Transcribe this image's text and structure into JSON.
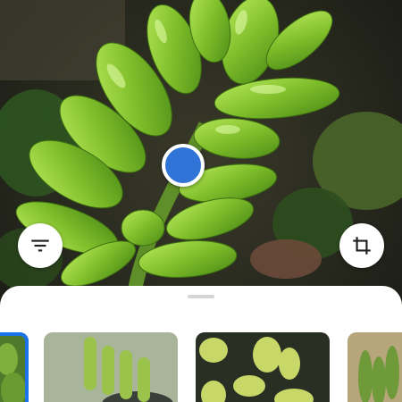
{
  "screen": {
    "background_color": "#1b1f16"
  },
  "photo": {
    "subject": "jelly-bean-succulent",
    "accent": "#7fbe2a"
  },
  "focus_marker": {
    "color": "#2f74d6"
  },
  "controls": {
    "filter_icon": "filter-icon",
    "crop_icon": "crop-icon"
  },
  "results_sheet": {
    "selected_index": 0,
    "accent_color": "#1a73e8",
    "thumbnails": [
      {
        "subject": "green-succulent"
      },
      {
        "subject": "potted-succulent"
      },
      {
        "subject": "yellow-green-succulent"
      },
      {
        "subject": "succulent-cluster"
      }
    ]
  }
}
